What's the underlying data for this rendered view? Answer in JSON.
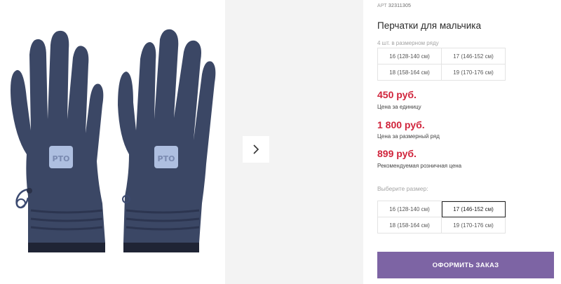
{
  "gallery": {
    "next_icon": "chevron-right-icon"
  },
  "product": {
    "art_label": "АРТ",
    "art_number": "32311305",
    "title": "Перчатки для мальчика",
    "series_note": "4 шт. в размерном ряду",
    "series_sizes": [
      "16 (128-140 см)",
      "17 (146-152 см)",
      "18 (158-164 см)",
      "19 (170-176 см)"
    ],
    "prices": [
      {
        "value": "450 руб.",
        "caption": "Цена за единицу"
      },
      {
        "value": "1 800 руб.",
        "caption": "Цена за размерный ряд"
      },
      {
        "value": "899 руб.",
        "caption": "Рекомендуемая розничная цена"
      }
    ],
    "choose_size_label": "Выберите размер:",
    "size_options": [
      "16 (128-140 см)",
      "17 (146-152 см)",
      "18 (158-164 см)",
      "19 (170-176 см)"
    ],
    "selected_size": "17 (146-152 см)",
    "order_button": "ОФОРМИТЬ ЗАКАЗ"
  },
  "colors": {
    "price": "#d0243b",
    "button": "#7d64a4",
    "glove": "#3a4664"
  }
}
